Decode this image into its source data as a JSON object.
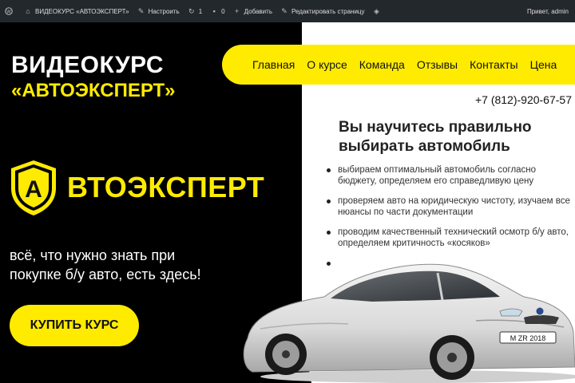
{
  "adminbar": {
    "wp_logo": "wordpress-icon",
    "site_name": "ВИДЕОКУРС «АВТОЭКСПЕРТ»",
    "customize": "Настроить",
    "updates_count": "1",
    "comments_count": "0",
    "add_new": "Добавить",
    "edit_page": "Редактировать страницу",
    "greeting": "Привет, admin"
  },
  "hero": {
    "title_line1": "ВИДЕОКУРС",
    "title_line2": "«АВТОЭКСПЕРТ»",
    "logo_letter": "А",
    "logo_text": "ВТОЭКСПЕРТ",
    "tagline": "всё, что нужно знать при покупке б/у авто, есть здесь!",
    "buy_button": "КУПИТЬ КУРС"
  },
  "nav": {
    "items": [
      "Главная",
      "О курсе",
      "Команда",
      "Отзывы",
      "Контакты",
      "Цена"
    ]
  },
  "contact": {
    "phone": "+7 (812)-920-67-57"
  },
  "content": {
    "headline": "Вы научитесь правильно выбирать автомобиль",
    "bullets": [
      "выбираем оптимальный автомобиль согласно бюджету, определяем его справедливую цену",
      "проверяем авто на юридическую чистоту, изучаем все нюансы по части документации",
      "проводим качественный технический осмотр б/у авто, определяем критичность «косяков»",
      ""
    ]
  },
  "car": {
    "plate": "M ZR 2018"
  },
  "colors": {
    "accent": "#ffeb00",
    "dark": "#000000",
    "adminbar": "#23282d"
  }
}
